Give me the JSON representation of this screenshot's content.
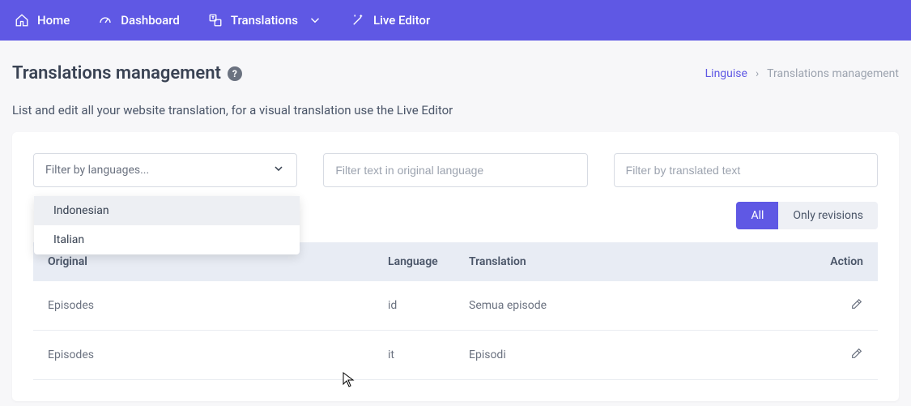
{
  "nav": {
    "home": "Home",
    "dashboard": "Dashboard",
    "translations": "Translations",
    "live_editor": "Live Editor"
  },
  "page": {
    "title": "Translations management",
    "help_glyph": "?",
    "subtitle": "List and edit all your website translation, for a visual translation use the Live Editor"
  },
  "breadcrumb": {
    "root": "Linguise",
    "sep": "›",
    "current": "Translations management"
  },
  "filters": {
    "lang_placeholder": "Filter by languages...",
    "orig_placeholder": "Filter text in original language",
    "trans_placeholder": "Filter by translated text",
    "dropdown": {
      "0": "Indonesian",
      "1": "Italian"
    }
  },
  "toggle": {
    "all": "All",
    "revisions": "Only revisions"
  },
  "table": {
    "headers": {
      "original": "Original",
      "language": "Language",
      "translation": "Translation",
      "action": "Action"
    },
    "rows": {
      "0": {
        "original": "Episodes",
        "lang": "id",
        "trans": "Semua episode"
      },
      "1": {
        "original": "Episodes",
        "lang": "it",
        "trans": "Episodi"
      }
    }
  }
}
